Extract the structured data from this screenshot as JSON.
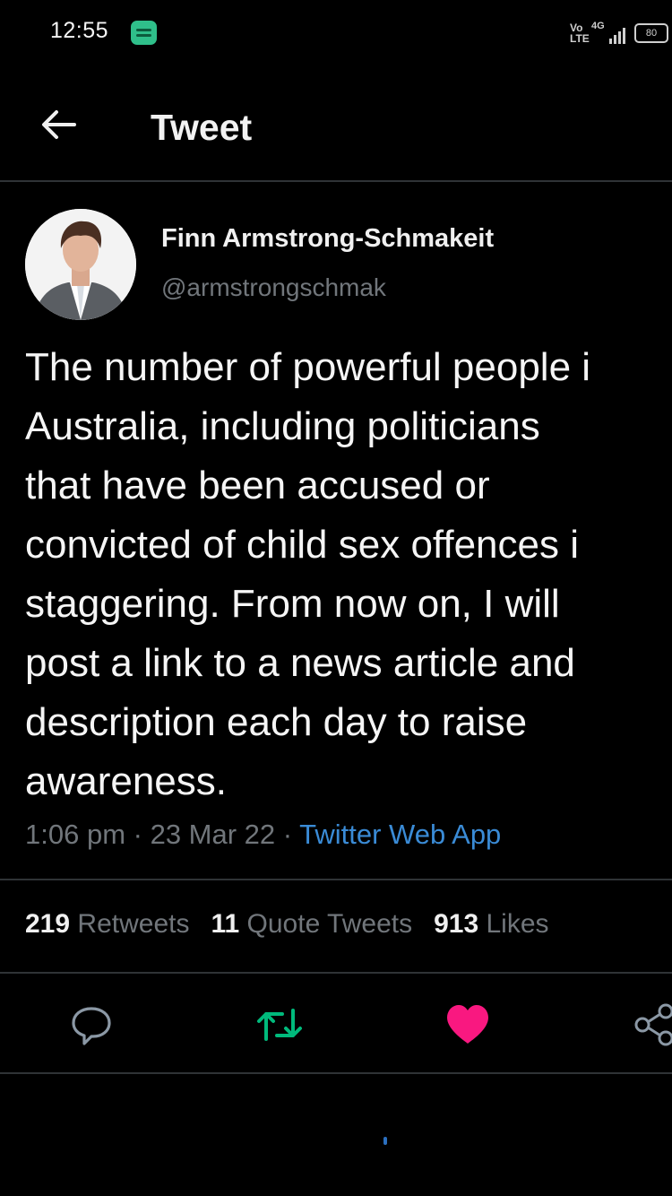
{
  "status_bar": {
    "time": "12:55",
    "network": "4G",
    "volte": "Vo LTE",
    "battery": "80"
  },
  "header": {
    "title": "Tweet"
  },
  "tweet": {
    "author_name": "Finn Armstrong-Schmakeit",
    "author_handle": "@armstrongschmak",
    "text_lines": [
      "The number of powerful people i",
      "Australia, including politicians",
      "that have been accused or",
      "convicted of child sex offences i",
      "staggering. From now on, I will",
      "post a link to a news article and",
      "description each day to raise",
      "awareness."
    ],
    "time": "1:06 pm",
    "date": "23 Mar 22",
    "separator": " · ",
    "source": "Twitter Web App"
  },
  "stats": {
    "retweets_count": "219",
    "retweets_label": "Retweets",
    "quotes_count": "11",
    "quotes_label": "Quote Tweets",
    "likes_count": "913",
    "likes_label": "Likes"
  },
  "icons": {
    "back": "back-arrow-icon",
    "reply": "reply-icon",
    "retweet": "retweet-icon",
    "like": "heart-icon",
    "share": "share-icon"
  },
  "colors": {
    "background": "#000000",
    "retweet_active": "#00ba7c",
    "like_active": "#f91880",
    "link": "#3a8bd6",
    "secondary_text": "#71767b"
  }
}
